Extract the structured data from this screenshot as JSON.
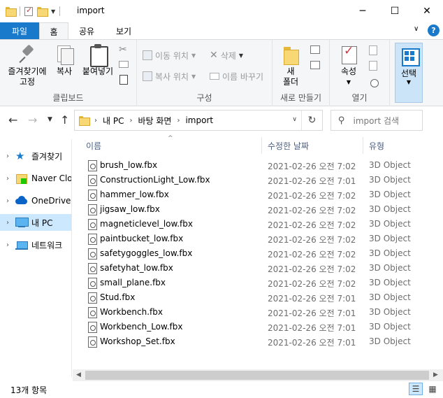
{
  "window": {
    "title": "import",
    "minimize_glyph": "─",
    "maximize_glyph": "☐",
    "close_glyph": "✕"
  },
  "ribbon_tabs": {
    "file": "파일",
    "home": "홈",
    "share": "공유",
    "view": "보기",
    "collapse_glyph": "∨",
    "help_glyph": "?"
  },
  "ribbon": {
    "clipboard": {
      "pin_line1": "즐겨찾기에",
      "pin_line2": "고정",
      "copy": "복사",
      "paste": "붙여넣기",
      "label": "클립보드"
    },
    "organize": {
      "move_to": "이동 위치",
      "copy_to": "복사 위치",
      "delete": "삭제",
      "rename": "이름 바꾸기",
      "label": "구성"
    },
    "new": {
      "new_folder_line1": "새",
      "new_folder_line2": "폴더",
      "label": "새로 만들기"
    },
    "open": {
      "properties": "속성",
      "label": "열기"
    },
    "select": {
      "label": "선택"
    }
  },
  "address": {
    "crumbs": [
      "내 PC",
      "바탕 화면",
      "import"
    ],
    "search_placeholder": "import 검색"
  },
  "nav_pane": {
    "items": [
      {
        "label": "즐겨찾기",
        "icon": "star-icon"
      },
      {
        "label": "Naver Cloud",
        "icon": "naver-cloud-icon"
      },
      {
        "label": "OneDrive",
        "icon": "onedrive-icon"
      },
      {
        "label": "내 PC",
        "icon": "this-pc-icon"
      },
      {
        "label": "네트워크",
        "icon": "network-icon"
      }
    ]
  },
  "columns": {
    "name": "이름",
    "date": "수정한 날짜",
    "type": "유형"
  },
  "files": [
    {
      "name": "brush_low.fbx",
      "date": "2021-02-26 오전 7:02",
      "type": "3D Object"
    },
    {
      "name": "ConstructionLight_Low.fbx",
      "date": "2021-02-26 오전 7:01",
      "type": "3D Object"
    },
    {
      "name": "hammer_low.fbx",
      "date": "2021-02-26 오전 7:02",
      "type": "3D Object"
    },
    {
      "name": "jigsaw_low.fbx",
      "date": "2021-02-26 오전 7:02",
      "type": "3D Object"
    },
    {
      "name": "magneticlevel_low.fbx",
      "date": "2021-02-26 오전 7:02",
      "type": "3D Object"
    },
    {
      "name": "paintbucket_low.fbx",
      "date": "2021-02-26 오전 7:02",
      "type": "3D Object"
    },
    {
      "name": "safetygoggles_low.fbx",
      "date": "2021-02-26 오전 7:02",
      "type": "3D Object"
    },
    {
      "name": "safetyhat_low.fbx",
      "date": "2021-02-26 오전 7:02",
      "type": "3D Object"
    },
    {
      "name": "small_plane.fbx",
      "date": "2021-02-26 오전 7:02",
      "type": "3D Object"
    },
    {
      "name": "Stud.fbx",
      "date": "2021-02-26 오전 7:01",
      "type": "3D Object"
    },
    {
      "name": "Workbench.fbx",
      "date": "2021-02-26 오전 7:01",
      "type": "3D Object"
    },
    {
      "name": "Workbench_Low.fbx",
      "date": "2021-02-26 오전 7:01",
      "type": "3D Object"
    },
    {
      "name": "Workshop_Set.fbx",
      "date": "2021-02-26 오전 7:01",
      "type": "3D Object"
    }
  ],
  "status": {
    "item_count": "13개 항목"
  },
  "colors": {
    "accent": "#1979ca",
    "selection": "#cce8ff",
    "ribbon_bg": "#f5f6f7"
  }
}
